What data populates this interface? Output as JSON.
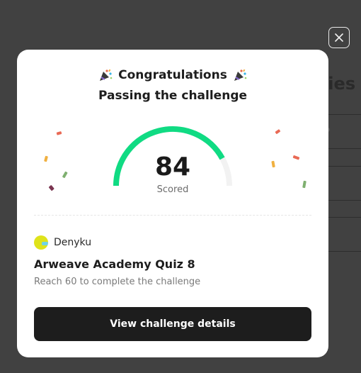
{
  "background": {
    "heading_fragment": "rties"
  },
  "close_button": {
    "icon": "close-icon"
  },
  "modal": {
    "title": "Congratulations",
    "title_icon": "party-popper-icon",
    "subtitle": "Passing the challenge",
    "score": {
      "value": "84",
      "label": "Scored",
      "max": 100,
      "fraction": 0.84,
      "fill_color": "#10db83",
      "track_color": "#f2f2f2"
    },
    "author": {
      "name": "Denyku",
      "avatar_color": "#dfe31a"
    },
    "quiz_title": "Arweave Academy Quiz 8",
    "description": "Reach 60 to complete the challenge",
    "cta_label": "View challenge details"
  }
}
